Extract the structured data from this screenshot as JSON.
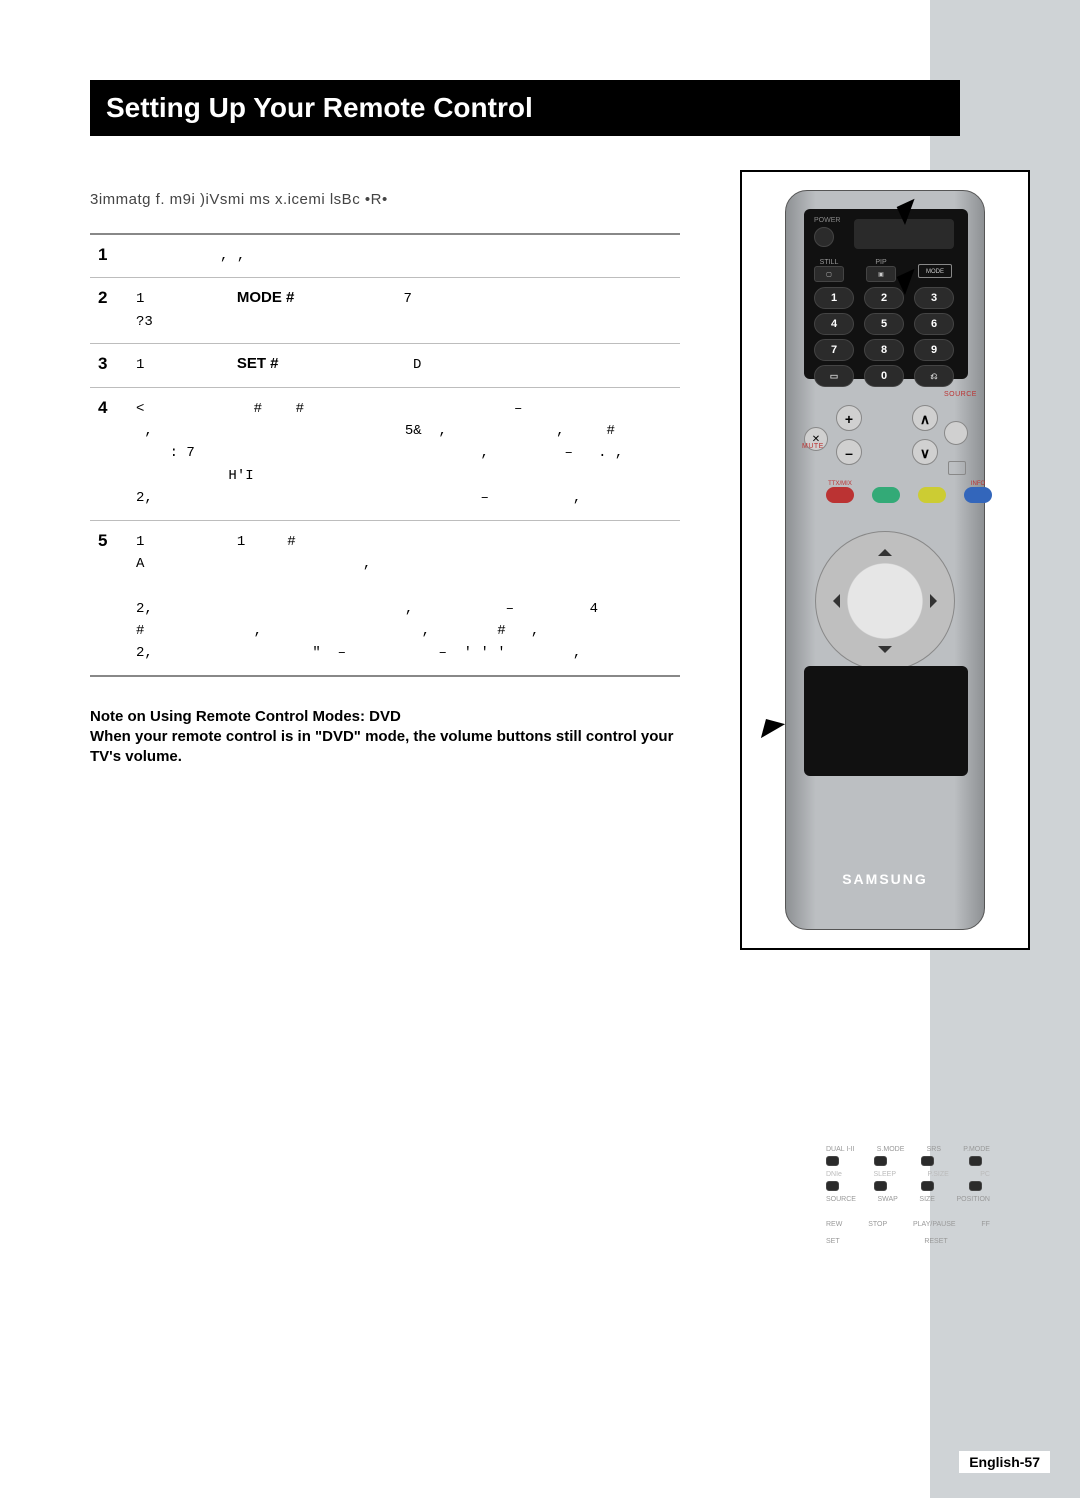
{
  "title": "Setting Up Your Remote Control",
  "intro": "3immatg f. m9i )iVsmi ms x.icemi lsBc •R•",
  "steps": [
    {
      "num": "1",
      "kw": "",
      "body": "          , ,"
    },
    {
      "num": "2",
      "kw": "MODE #",
      "body": "1                        7\n?3"
    },
    {
      "num": "3",
      "kw": "SET #",
      "body": "1                              D"
    },
    {
      "num": "4",
      "kw": "",
      "body": "<             #    #                         –\n ,                              5&  ,             ,     #\n    : 7                                  ,         –   . ,\n           H'I\n2,                                       –          ,"
    },
    {
      "num": "5",
      "kw": "",
      "body": "1           1     #\nA                          ,\n\n2,                              ,           –         4\n#             ,                   ,        #   ,\n2,                   \"  –           –  ' ' '        ,"
    }
  ],
  "note_line1": "Note on Using Remote Control Modes: DVD",
  "note_line2": "When your remote control is in \"DVD\" mode, the volume buttons still control your TV's volume.",
  "footer": "English-57",
  "remote": {
    "power": "POWER",
    "still": "STILL",
    "pip": "PIP",
    "mode": "MODE",
    "numbers": [
      "1",
      "2",
      "3",
      "4",
      "5",
      "6",
      "7",
      "8",
      "9",
      "–/––",
      "0",
      "PRE-CH"
    ],
    "mute": "MUTE",
    "source": "SOURCE",
    "color_labels": [
      "TTX/MIX",
      "",
      "",
      "INFO"
    ],
    "row1": [
      "DUAL I-II",
      "S.MODE",
      "SRS",
      "P.MODE"
    ],
    "row2": [
      "DNIe",
      "SLEEP",
      "P.SIZE",
      "PC"
    ],
    "row3": [
      "SOURCE",
      "SWAP",
      "SIZE",
      "POSITION"
    ],
    "row4": [
      "REW",
      "STOP",
      "PLAY/PAUSE",
      "FF"
    ],
    "row5": [
      "SET",
      "",
      "RESET",
      ""
    ],
    "brand": "SAMSUNG"
  }
}
